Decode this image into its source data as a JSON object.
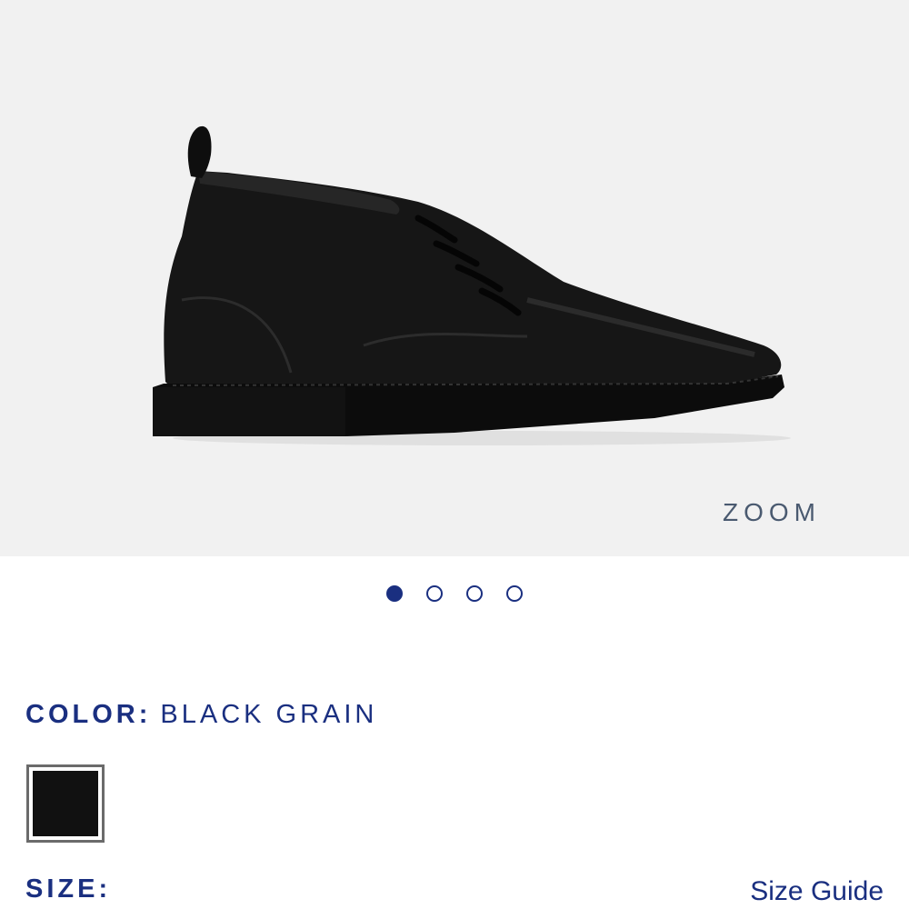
{
  "gallery": {
    "zoom_label": "ZOOM",
    "image_icon": "boot-product-image",
    "slide_count": 4,
    "active_slide": 1
  },
  "color": {
    "label": "COLOR:",
    "value": "BLACK GRAIN",
    "swatch_color": "#111111"
  },
  "size": {
    "label": "SIZE:",
    "guide_label": "Size Guide"
  },
  "theme": {
    "accent": "#1a2f80",
    "gallery_bg": "#f1f1f1",
    "zoom_text": "#4a5a70"
  }
}
